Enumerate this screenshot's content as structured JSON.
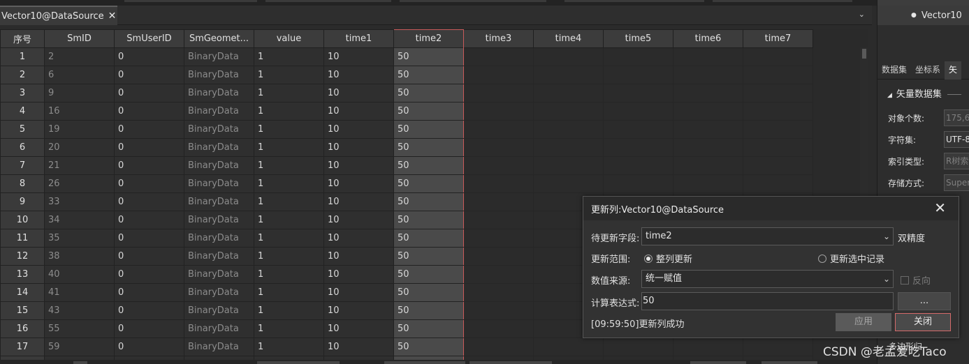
{
  "tab": {
    "label": "Vector10@DataSource",
    "close": "✕",
    "dropdown": "⌄"
  },
  "grid": {
    "columns": [
      "序号",
      "SmID",
      "SmUserID",
      "SmGeomet...",
      "value",
      "time1",
      "time2",
      "time3",
      "time4",
      "time5",
      "time6",
      "time7"
    ],
    "rows": [
      [
        "1",
        "2",
        "0",
        "BinaryData",
        "1",
        "10",
        "50"
      ],
      [
        "2",
        "6",
        "0",
        "BinaryData",
        "1",
        "10",
        "50"
      ],
      [
        "3",
        "9",
        "0",
        "BinaryData",
        "1",
        "10",
        "50"
      ],
      [
        "4",
        "16",
        "0",
        "BinaryData",
        "1",
        "10",
        "50"
      ],
      [
        "5",
        "19",
        "0",
        "BinaryData",
        "1",
        "10",
        "50"
      ],
      [
        "6",
        "20",
        "0",
        "BinaryData",
        "1",
        "10",
        "50"
      ],
      [
        "7",
        "21",
        "0",
        "BinaryData",
        "1",
        "10",
        "50"
      ],
      [
        "8",
        "26",
        "0",
        "BinaryData",
        "1",
        "10",
        "50"
      ],
      [
        "9",
        "33",
        "0",
        "BinaryData",
        "1",
        "10",
        "50"
      ],
      [
        "10",
        "34",
        "0",
        "BinaryData",
        "1",
        "10",
        "50"
      ],
      [
        "11",
        "35",
        "0",
        "BinaryData",
        "1",
        "10",
        "50"
      ],
      [
        "12",
        "38",
        "0",
        "BinaryData",
        "1",
        "10",
        "50"
      ],
      [
        "13",
        "40",
        "0",
        "BinaryData",
        "1",
        "10",
        "50"
      ],
      [
        "14",
        "41",
        "0",
        "BinaryData",
        "1",
        "10",
        "50"
      ],
      [
        "15",
        "43",
        "0",
        "BinaryData",
        "1",
        "10",
        "50"
      ],
      [
        "16",
        "55",
        "0",
        "BinaryData",
        "1",
        "10",
        "50"
      ],
      [
        "17",
        "59",
        "0",
        "BinaryData",
        "1",
        "10",
        "50"
      ],
      [
        "",
        "",
        "",
        "",
        "",
        "",
        ""
      ]
    ],
    "selected_column": "time2"
  },
  "right_panel": {
    "tree_node": "Vector10",
    "tabs": [
      "数据集",
      "坐标系",
      "矢"
    ],
    "section": "矢量数据集",
    "props": [
      {
        "label": "对象个数:",
        "value": "175,6"
      },
      {
        "label": "字符集:",
        "value": "UTF-8"
      },
      {
        "label": "索引类型:",
        "value": "R树索"
      },
      {
        "label": "存储方式:",
        "value": "Super"
      }
    ],
    "partial_label": "多边形归"
  },
  "dialog": {
    "title": "更新列:Vector10@DataSource",
    "close": "✕",
    "field_label": "待更新字段:",
    "field_value": "time2",
    "field_type": "双精度",
    "range_label": "更新范围:",
    "range_option_all": "整列更新",
    "range_option_selected": "更新选中记录",
    "source_label": "数值来源:",
    "source_value": "统一赋值",
    "reverse_label": "反向",
    "expr_label": "计算表达式:",
    "expr_value": "50",
    "ellipsis_label": "...",
    "status": "[09:59:50]更新列成功",
    "apply_label": "应用",
    "close_label": "关闭"
  },
  "watermark": "CSDN @老孟爱吃Taco"
}
